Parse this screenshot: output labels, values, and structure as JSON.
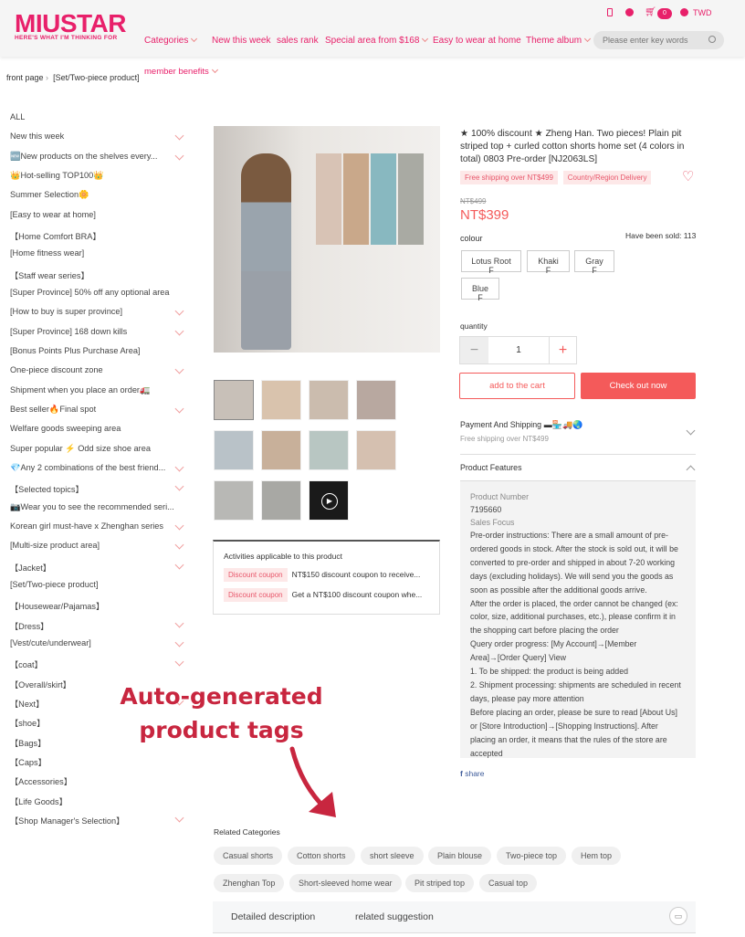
{
  "header": {
    "logo": "MIUSTAR",
    "tagline": "HERE'S WHAT I'M THINKING FOR",
    "nav": [
      {
        "label": "Categories",
        "chev": true
      },
      {
        "label": "New this week"
      },
      {
        "label": "sales rank"
      },
      {
        "label": "Special area from $168",
        "chev": true
      },
      {
        "label": "Easy to wear at home"
      },
      {
        "label": "Theme album",
        "chev": true
      }
    ],
    "member": "member benefits",
    "search_placeholder": "Please enter key words",
    "cart_count": "0",
    "currency": "TWD",
    "brand_color": "#e8206a"
  },
  "breadcrumb": [
    "front page",
    "[Set/Two-piece product]"
  ],
  "sidebar": [
    {
      "label": "ALL"
    },
    {
      "label": "New this week",
      "chev": true
    },
    {
      "label": "🆕New products on the shelves every...",
      "chev": true
    },
    {
      "label": "👑Hot-selling TOP100👑"
    },
    {
      "label": "Summer Selection🌼"
    },
    {
      "label": "[Easy to wear at home]"
    },
    {
      "label": "【Home Comfort BRA】"
    },
    {
      "label": "[Home fitness wear]"
    },
    {
      "label": "【Staff wear series】"
    },
    {
      "label": "[Super Province] 50% off any optional area"
    },
    {
      "label": "[How to buy is super province]",
      "chev": true
    },
    {
      "label": "[Super Province] 168 down kills",
      "chev": true
    },
    {
      "label": "[Bonus Points Plus Purchase Area]"
    },
    {
      "label": "One-piece discount zone",
      "chev": true
    },
    {
      "label": "Shipment when you place an order🚛"
    },
    {
      "label": "Best seller🔥Final spot",
      "chev": true
    },
    {
      "label": "Welfare goods sweeping area"
    },
    {
      "label": "Super popular ⚡ Odd size shoe area"
    },
    {
      "label": "💎Any 2 combinations of the best friend...",
      "chev": true
    },
    {
      "label": "【Selected topics】",
      "chev": true
    },
    {
      "label": "📷Wear you to see the recommended seri..."
    },
    {
      "label": "Korean girl must-have x Zhenghan series",
      "chev": true
    },
    {
      "label": "[Multi-size product area]",
      "chev": true
    },
    {
      "label": "【Jacket】",
      "chev": true
    },
    {
      "label": "[Set/Two-piece product]"
    },
    {
      "label": "【Housewear/Pajamas】"
    },
    {
      "label": "【Dress】",
      "chev": true
    },
    {
      "label": "[Vest/cute/underwear]",
      "chev": true
    },
    {
      "label": "【coat】",
      "chev": true
    },
    {
      "label": "【Overall/skirt】"
    },
    {
      "label": "【Next】",
      "chev": true
    },
    {
      "label": "【shoe】"
    },
    {
      "label": "【Bags】"
    },
    {
      "label": "【Caps】"
    },
    {
      "label": "【Accessories】"
    },
    {
      "label": "【Life Goods】"
    },
    {
      "label": "【Shop Manager's Selection】",
      "chev": true
    }
  ],
  "product": {
    "title": "★ 100% discount ★ Zheng Han. Two pieces! Plain pit striped top + curled cotton shorts home set (4 colors in total) 0803 Pre-order [NJ2063LS]",
    "tags": [
      "Free shipping over NT$499",
      "Country/Region Delivery"
    ],
    "old_price": "NT$499",
    "price": "NT$399",
    "colour_label": "colour",
    "sold": "Have been sold: 113",
    "colours": [
      "Lotus Root F",
      "Khaki F",
      "Gray F",
      "Blue F"
    ],
    "quantity_label": "quantity",
    "quantity": "1",
    "add_to_cart": "add to the cart",
    "checkout": "Check out now",
    "accent": "#f45a5a"
  },
  "payment": {
    "title": "Payment And Shipping",
    "sub": "Free shipping over NT$499"
  },
  "features": {
    "title": "Product Features",
    "number_label": "Product Number",
    "number": "7195660",
    "focus_label": "Sales Focus",
    "text": [
      "Pre-order instructions: There are a small amount of pre-ordered goods in stock. After the stock is sold out, it will be converted to pre-order and shipped in about 7-20 working days (excluding holidays). We will send you the goods as soon as possible after the additional goods arrive.",
      "After the order is placed, the order cannot be changed (ex: color, size, additional purchases, etc.), please confirm it in the shopping cart before placing the order",
      "Query order progress: [My Account]→[Member Area]→[Order Query] View",
      "1. To be shipped: the product is being added",
      "2. Shipment processing: shipments are scheduled in recent days, please pay more attention",
      "Before placing an order, please be sure to read [About Us] or [Store Introduction]→[Shopping Instructions]. After placing an order, it means that the rules of the store are accepted"
    ]
  },
  "share": "share",
  "activities": {
    "title": "Activities applicable to this product",
    "items": [
      {
        "tag": "Discount coupon",
        "text": "NT$150 discount coupon to receive..."
      },
      {
        "tag": "Discount coupon",
        "text": "Get a NT$100 discount coupon whe..."
      }
    ]
  },
  "related": {
    "title": "Related Categories",
    "tags": [
      "Casual shorts",
      "Cotton shorts",
      "short sleeve",
      "Plain blouse",
      "Two-piece top",
      "Hem top",
      "Zhenghan Top",
      "Short-sleeved home wear",
      "Pit striped top",
      "Casual top"
    ]
  },
  "tabs": [
    "Detailed description",
    "related suggestion"
  ],
  "annotation": {
    "lines": [
      "Auto-generated",
      "product tags"
    ],
    "color": "#c8263f"
  }
}
